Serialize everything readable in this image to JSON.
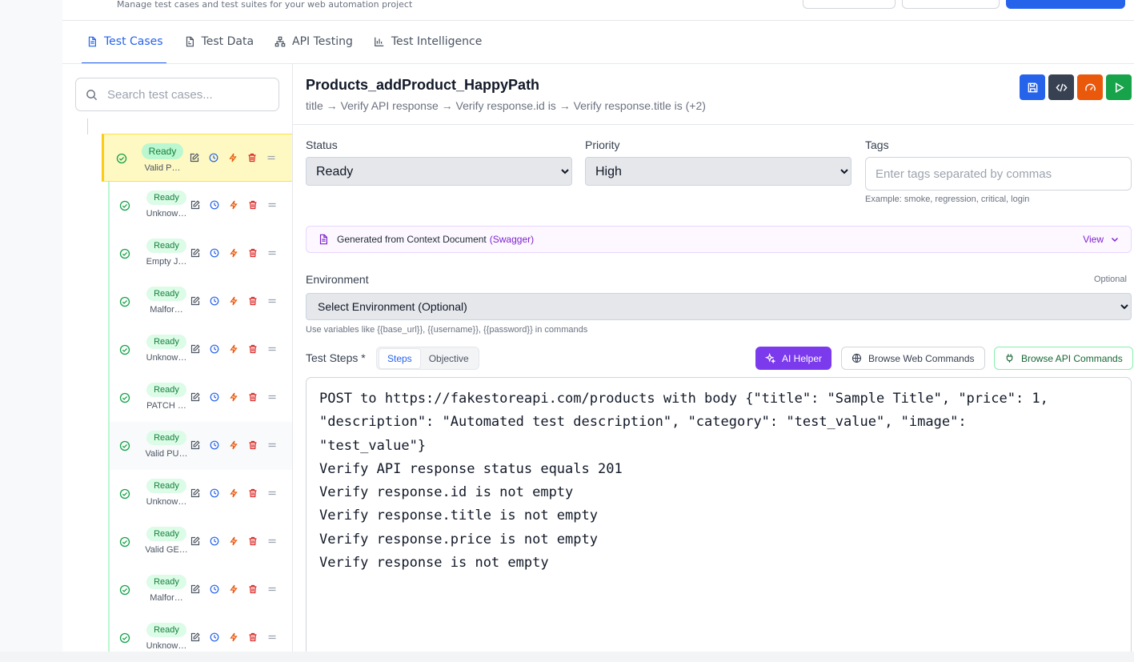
{
  "header": {
    "subtitle": "Manage test cases and test suites for your web automation project"
  },
  "tabs": [
    {
      "label": "Test Cases",
      "icon": "file-text-icon",
      "active": true
    },
    {
      "label": "Test Data",
      "icon": "file-data-icon",
      "active": false
    },
    {
      "label": "API Testing",
      "icon": "network-icon",
      "active": false
    },
    {
      "label": "Test Intelligence",
      "icon": "bar-chart-icon",
      "active": false
    }
  ],
  "sidebar": {
    "search_placeholder": "Search test cases...",
    "items": [
      {
        "status": "Ready",
        "name": "Valid P…",
        "selected": true
      },
      {
        "status": "Ready",
        "name": "Unknow…"
      },
      {
        "status": "Ready",
        "name": "Empty J…"
      },
      {
        "status": "Ready",
        "name": "Malfor…"
      },
      {
        "status": "Ready",
        "name": "Unknow…"
      },
      {
        "status": "Ready",
        "name": "PATCH …"
      },
      {
        "status": "Ready",
        "name": "Valid PU…",
        "hover": true
      },
      {
        "status": "Ready",
        "name": "Unknow…"
      },
      {
        "status": "Ready",
        "name": "Valid GE…"
      },
      {
        "status": "Ready",
        "name": "Malfor…"
      },
      {
        "status": "Ready",
        "name": "Unknow…"
      }
    ]
  },
  "test_case": {
    "title": "Products_addProduct_HappyPath",
    "summary": "title → Verify API response → Verify response.id is → Verify response.title is (+2)",
    "status_label": "Status",
    "status_value": "Ready",
    "priority_label": "Priority",
    "priority_value": "High",
    "tags_label": "Tags",
    "tags_placeholder": "Enter tags separated by commas",
    "tags_hint": "Example: smoke, regression, critical, login",
    "context_text": "Generated from Context Document",
    "context_source": "(Swagger)",
    "context_view": "View",
    "env_label": "Environment",
    "env_optional": "Optional",
    "env_value": "Select Environment (Optional)",
    "env_hint": "Use variables like {{base_url}}, {{username}}, {{password}} in commands",
    "steps_label": "Test Steps *",
    "steps_tab": "Steps",
    "objective_tab": "Objective",
    "ai_helper": "AI Helper",
    "browse_web": "Browse Web Commands",
    "browse_api": "Browse API Commands",
    "steps": [
      "POST to https://fakestoreapi.com/products with body {\"title\": \"Sample Title\", \"price\": 1,",
      "\"description\": \"Automated test description\", \"category\": \"test_value\", \"image\":",
      "\"test_value\"}",
      "Verify API response status equals 201",
      "Verify response.id is not empty",
      "Verify response.title is not empty",
      "Verify response.price is not empty",
      "Verify response is not empty"
    ]
  },
  "colors": {
    "accent": "#2563eb",
    "ready_badge": "#dcfce7",
    "selected_row": "#fef9c3",
    "ai_helper": "#7c3aed"
  }
}
